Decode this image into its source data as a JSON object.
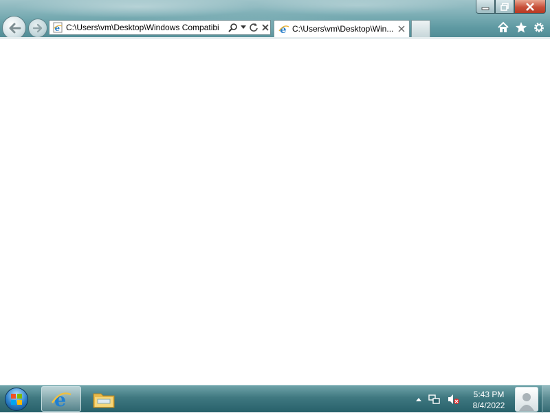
{
  "window": {
    "minimize_icon": "minimize-icon",
    "restore_icon": "restore-icon",
    "close_icon": "close-icon"
  },
  "navigation": {
    "back_icon": "back-arrow-icon",
    "forward_icon": "forward-arrow-icon"
  },
  "address_bar": {
    "value": "C:\\Users\\vm\\Desktop\\Windows Compatibi",
    "page_icon": "ie-page-icon",
    "search_icon": "search-icon",
    "dropdown_icon": "chevron-down-icon",
    "refresh_icon": "refresh-icon",
    "stop_icon": "stop-icon"
  },
  "tabs": [
    {
      "label": "C:\\Users\\vm\\Desktop\\Win...",
      "icon": "ie-tab-icon",
      "close_icon": "close-icon"
    }
  ],
  "command_icons": {
    "home": "home-icon",
    "favorites": "star-icon",
    "tools": "gear-icon"
  },
  "taskbar": {
    "start": "windows-start-icon",
    "pinned": [
      "internet-explorer-icon",
      "folder-icon"
    ],
    "tray": [
      "chevron-up-icon",
      "network-icon",
      "volume-muted-icon"
    ],
    "clock": {
      "time": "5:43 PM",
      "date": "8/4/2022"
    },
    "user_tile": "user-icon"
  },
  "colors": {
    "chrome": "#6fa3a9",
    "taskbar": "#3f7880",
    "close_button": "#c7503a",
    "content_bg": "#ffffff"
  }
}
